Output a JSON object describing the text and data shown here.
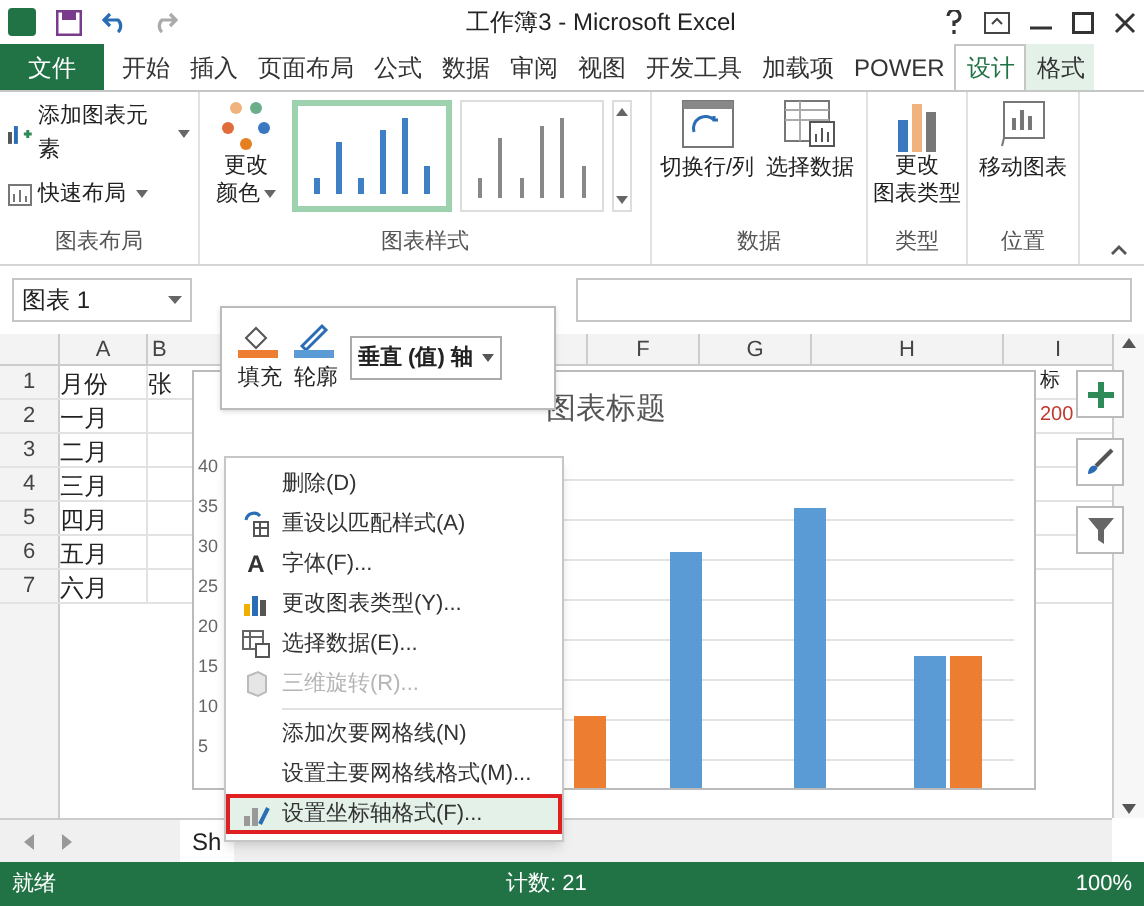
{
  "window": {
    "title": "工作簿3 - Microsoft Excel"
  },
  "tabs": [
    {
      "label": "文件",
      "kind": "file",
      "selected": false
    },
    {
      "label": "开始",
      "kind": "normal",
      "selected": false
    },
    {
      "label": "插入",
      "kind": "normal",
      "selected": false
    },
    {
      "label": "页面布局",
      "kind": "normal",
      "selected": false
    },
    {
      "label": "公式",
      "kind": "normal",
      "selected": false
    },
    {
      "label": "数据",
      "kind": "normal",
      "selected": false
    },
    {
      "label": "审阅",
      "kind": "normal",
      "selected": false
    },
    {
      "label": "视图",
      "kind": "normal",
      "selected": false
    },
    {
      "label": "开发工具",
      "kind": "normal",
      "selected": false
    },
    {
      "label": "加载项",
      "kind": "normal",
      "selected": false
    },
    {
      "label": "POWER",
      "kind": "normal",
      "selected": false
    },
    {
      "label": "设计",
      "kind": "contextual",
      "selected": true
    },
    {
      "label": "格式",
      "kind": "contextual",
      "selected": false
    }
  ],
  "ribbon": {
    "layout_group": {
      "label": "图表布局",
      "add_element": "添加图表元素",
      "quick_layout": "快速布局"
    },
    "styles_group": {
      "label": "图表样式",
      "change_colors": [
        "更改",
        "颜色"
      ]
    },
    "data_group": {
      "label": "数据",
      "switch": "切换行/列",
      "select": "选择数据"
    },
    "type_group": {
      "label": "类型",
      "change_type": [
        "更改",
        "图表类型"
      ]
    },
    "location_group": {
      "label": "位置",
      "move": "移动图表"
    }
  },
  "name_box": "图表 1",
  "columns": [
    "A",
    "B",
    "F",
    "G",
    "H",
    "I"
  ],
  "rows": [
    {
      "num": "1",
      "a": "月份",
      "b": "张",
      "i": "标"
    },
    {
      "num": "2",
      "a": "一月",
      "i": "200"
    },
    {
      "num": "3",
      "a": "二月"
    },
    {
      "num": "4",
      "a": "三月"
    },
    {
      "num": "5",
      "a": "四月"
    },
    {
      "num": "6",
      "a": "五月"
    },
    {
      "num": "7",
      "a": "六月"
    }
  ],
  "chart": {
    "title": "图表标题",
    "y_labels": [
      "40",
      "35",
      "30",
      "25",
      "20",
      "15",
      "10",
      "5"
    ]
  },
  "mini_toolbar": {
    "fill": "填充",
    "outline": "轮廓",
    "element": "垂直 (值) 轴"
  },
  "context_menu": [
    {
      "label": "删除(D)",
      "kind": "plain",
      "disabled": false,
      "highlighted": false
    },
    {
      "label": "重设以匹配样式(A)",
      "kind": "reset",
      "disabled": false,
      "highlighted": false
    },
    {
      "label": "字体(F)...",
      "kind": "font",
      "icon_text": "A",
      "disabled": false,
      "highlighted": false
    },
    {
      "label": "更改图表类型(Y)...",
      "kind": "charttype",
      "disabled": false,
      "highlighted": false
    },
    {
      "label": "选择数据(E)...",
      "kind": "data",
      "disabled": false,
      "highlighted": false
    },
    {
      "label": "三维旋转(R)...",
      "kind": "rotate",
      "disabled": true,
      "highlighted": false
    },
    {
      "label": "添加次要网格线(N)",
      "kind": "plain",
      "disabled": false,
      "highlighted": false
    },
    {
      "label": "设置主要网格线格式(M)...",
      "kind": "plain",
      "disabled": false,
      "highlighted": false
    },
    {
      "label": "设置坐标轴格式(F)...",
      "kind": "axis",
      "disabled": false,
      "highlighted": true
    }
  ],
  "sheet_tab": "Sh",
  "status_bar": {
    "ready": "就绪",
    "count": "计数: 21",
    "zoom": "100%"
  }
}
